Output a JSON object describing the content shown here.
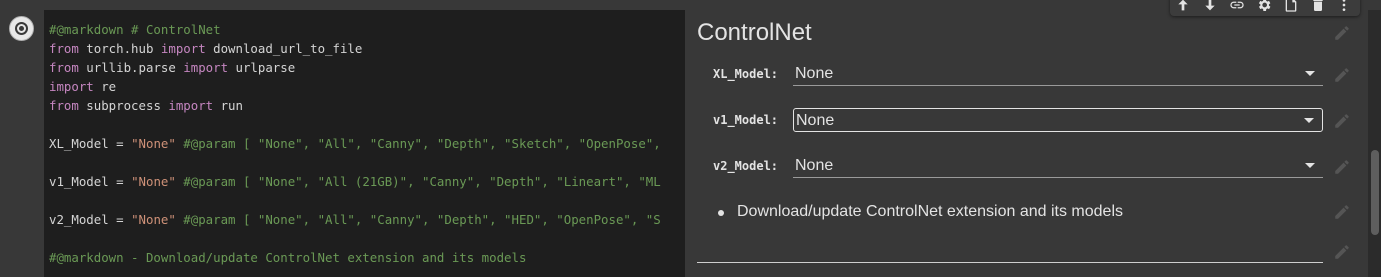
{
  "code": {
    "lines": [
      [
        {
          "t": "#@markdown # ControlNet",
          "c": "cm"
        }
      ],
      [
        {
          "t": "from",
          "c": "kw"
        },
        {
          "t": " torch.hub ",
          "c": ""
        },
        {
          "t": "import",
          "c": "kw"
        },
        {
          "t": " download_url_to_file",
          "c": ""
        }
      ],
      [
        {
          "t": "from",
          "c": "kw"
        },
        {
          "t": " urllib.parse ",
          "c": ""
        },
        {
          "t": "import",
          "c": "kw"
        },
        {
          "t": " urlparse",
          "c": ""
        }
      ],
      [
        {
          "t": "import",
          "c": "kw"
        },
        {
          "t": " re",
          "c": ""
        }
      ],
      [
        {
          "t": "from",
          "c": "kw"
        },
        {
          "t": " subprocess ",
          "c": ""
        },
        {
          "t": "import",
          "c": "kw"
        },
        {
          "t": " run",
          "c": ""
        }
      ],
      [
        {
          "t": "",
          "c": ""
        }
      ],
      [
        {
          "t": "XL_Model = ",
          "c": ""
        },
        {
          "t": "\"None\"",
          "c": "str"
        },
        {
          "t": " #@param [ \"None\", \"All\", \"Canny\", \"Depth\", \"Sketch\", \"OpenPose\",",
          "c": "cm"
        }
      ],
      [
        {
          "t": "",
          "c": ""
        }
      ],
      [
        {
          "t": "v1_Model = ",
          "c": ""
        },
        {
          "t": "\"None\"",
          "c": "str"
        },
        {
          "t": " #@param [ \"None\", \"All (21GB)\", \"Canny\", \"Depth\", \"Lineart\", \"ML",
          "c": "cm"
        }
      ],
      [
        {
          "t": "",
          "c": ""
        }
      ],
      [
        {
          "t": "v2_Model = ",
          "c": ""
        },
        {
          "t": "\"None\"",
          "c": "str"
        },
        {
          "t": " #@param [ \"None\", \"All\", \"Canny\", \"Depth\", \"HED\", \"OpenPose\", \"S",
          "c": "cm"
        }
      ],
      [
        {
          "t": "",
          "c": ""
        }
      ],
      [
        {
          "t": "#@markdown - Download/update ControlNet extension and its models",
          "c": "cm"
        }
      ]
    ]
  },
  "form": {
    "title": "ControlNet",
    "fields": [
      {
        "label": "XL_Model:",
        "value": "None"
      },
      {
        "label": "v1_Model:",
        "value": "None"
      },
      {
        "label": "v2_Model:",
        "value": "None"
      }
    ],
    "bullet": "Download/update ControlNet extension and its models"
  },
  "toolbar": {
    "icons": [
      "arrow-up-icon",
      "arrow-down-icon",
      "link-icon",
      "gear-icon",
      "mirror-cell-icon",
      "delete-icon",
      "more-icon"
    ]
  }
}
